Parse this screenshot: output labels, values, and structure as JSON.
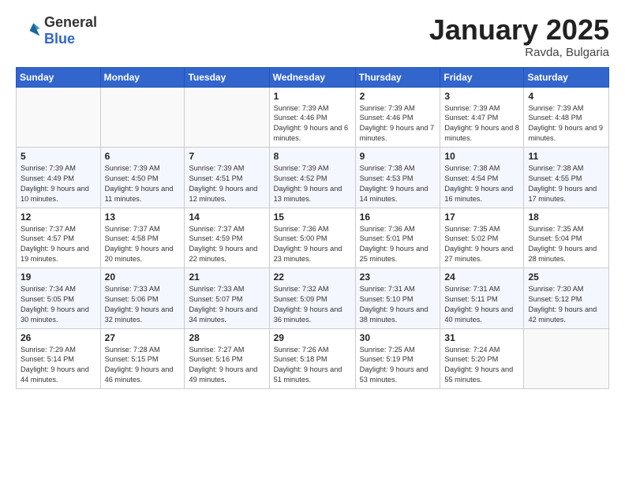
{
  "logo": {
    "general": "General",
    "blue": "Blue"
  },
  "title": "January 2025",
  "location": "Ravda, Bulgaria",
  "weekdays": [
    "Sunday",
    "Monday",
    "Tuesday",
    "Wednesday",
    "Thursday",
    "Friday",
    "Saturday"
  ],
  "weeks": [
    [
      {
        "day": "",
        "info": ""
      },
      {
        "day": "",
        "info": ""
      },
      {
        "day": "",
        "info": ""
      },
      {
        "day": "1",
        "info": "Sunrise: 7:39 AM\nSunset: 4:46 PM\nDaylight: 9 hours and 6 minutes."
      },
      {
        "day": "2",
        "info": "Sunrise: 7:39 AM\nSunset: 4:46 PM\nDaylight: 9 hours and 7 minutes."
      },
      {
        "day": "3",
        "info": "Sunrise: 7:39 AM\nSunset: 4:47 PM\nDaylight: 9 hours and 8 minutes."
      },
      {
        "day": "4",
        "info": "Sunrise: 7:39 AM\nSunset: 4:48 PM\nDaylight: 9 hours and 9 minutes."
      }
    ],
    [
      {
        "day": "5",
        "info": "Sunrise: 7:39 AM\nSunset: 4:49 PM\nDaylight: 9 hours and 10 minutes."
      },
      {
        "day": "6",
        "info": "Sunrise: 7:39 AM\nSunset: 4:50 PM\nDaylight: 9 hours and 11 minutes."
      },
      {
        "day": "7",
        "info": "Sunrise: 7:39 AM\nSunset: 4:51 PM\nDaylight: 9 hours and 12 minutes."
      },
      {
        "day": "8",
        "info": "Sunrise: 7:39 AM\nSunset: 4:52 PM\nDaylight: 9 hours and 13 minutes."
      },
      {
        "day": "9",
        "info": "Sunrise: 7:38 AM\nSunset: 4:53 PM\nDaylight: 9 hours and 14 minutes."
      },
      {
        "day": "10",
        "info": "Sunrise: 7:38 AM\nSunset: 4:54 PM\nDaylight: 9 hours and 16 minutes."
      },
      {
        "day": "11",
        "info": "Sunrise: 7:38 AM\nSunset: 4:55 PM\nDaylight: 9 hours and 17 minutes."
      }
    ],
    [
      {
        "day": "12",
        "info": "Sunrise: 7:37 AM\nSunset: 4:57 PM\nDaylight: 9 hours and 19 minutes."
      },
      {
        "day": "13",
        "info": "Sunrise: 7:37 AM\nSunset: 4:58 PM\nDaylight: 9 hours and 20 minutes."
      },
      {
        "day": "14",
        "info": "Sunrise: 7:37 AM\nSunset: 4:59 PM\nDaylight: 9 hours and 22 minutes."
      },
      {
        "day": "15",
        "info": "Sunrise: 7:36 AM\nSunset: 5:00 PM\nDaylight: 9 hours and 23 minutes."
      },
      {
        "day": "16",
        "info": "Sunrise: 7:36 AM\nSunset: 5:01 PM\nDaylight: 9 hours and 25 minutes."
      },
      {
        "day": "17",
        "info": "Sunrise: 7:35 AM\nSunset: 5:02 PM\nDaylight: 9 hours and 27 minutes."
      },
      {
        "day": "18",
        "info": "Sunrise: 7:35 AM\nSunset: 5:04 PM\nDaylight: 9 hours and 28 minutes."
      }
    ],
    [
      {
        "day": "19",
        "info": "Sunrise: 7:34 AM\nSunset: 5:05 PM\nDaylight: 9 hours and 30 minutes."
      },
      {
        "day": "20",
        "info": "Sunrise: 7:33 AM\nSunset: 5:06 PM\nDaylight: 9 hours and 32 minutes."
      },
      {
        "day": "21",
        "info": "Sunrise: 7:33 AM\nSunset: 5:07 PM\nDaylight: 9 hours and 34 minutes."
      },
      {
        "day": "22",
        "info": "Sunrise: 7:32 AM\nSunset: 5:09 PM\nDaylight: 9 hours and 36 minutes."
      },
      {
        "day": "23",
        "info": "Sunrise: 7:31 AM\nSunset: 5:10 PM\nDaylight: 9 hours and 38 minutes."
      },
      {
        "day": "24",
        "info": "Sunrise: 7:31 AM\nSunset: 5:11 PM\nDaylight: 9 hours and 40 minutes."
      },
      {
        "day": "25",
        "info": "Sunrise: 7:30 AM\nSunset: 5:12 PM\nDaylight: 9 hours and 42 minutes."
      }
    ],
    [
      {
        "day": "26",
        "info": "Sunrise: 7:29 AM\nSunset: 5:14 PM\nDaylight: 9 hours and 44 minutes."
      },
      {
        "day": "27",
        "info": "Sunrise: 7:28 AM\nSunset: 5:15 PM\nDaylight: 9 hours and 46 minutes."
      },
      {
        "day": "28",
        "info": "Sunrise: 7:27 AM\nSunset: 5:16 PM\nDaylight: 9 hours and 49 minutes."
      },
      {
        "day": "29",
        "info": "Sunrise: 7:26 AM\nSunset: 5:18 PM\nDaylight: 9 hours and 51 minutes."
      },
      {
        "day": "30",
        "info": "Sunrise: 7:25 AM\nSunset: 5:19 PM\nDaylight: 9 hours and 53 minutes."
      },
      {
        "day": "31",
        "info": "Sunrise: 7:24 AM\nSunset: 5:20 PM\nDaylight: 9 hours and 55 minutes."
      },
      {
        "day": "",
        "info": ""
      }
    ]
  ]
}
